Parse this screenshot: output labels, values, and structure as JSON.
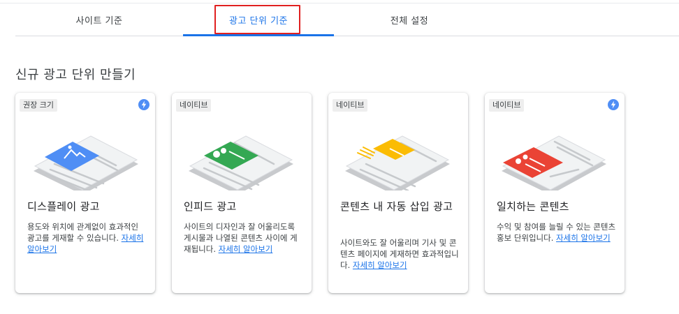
{
  "tabs": [
    {
      "label": "사이트 기준",
      "active": false
    },
    {
      "label": "광고 단위 기준",
      "active": true
    },
    {
      "label": "전체 설정",
      "active": false
    }
  ],
  "section_title": "신규 광고 단위 만들기",
  "colors": {
    "accent": "#1a73e8",
    "highlight_box": "#e02020",
    "display": "#4f8ef5",
    "infeed": "#34a853",
    "inarticle": "#fbbc04",
    "matched": "#ea4335"
  },
  "cards": [
    {
      "badge": "권장 크기",
      "has_bolt": true,
      "icon": "display-ad-illustration",
      "title": "디스플레이 광고",
      "desc": "용도와 위치에 관계없이 효과적인 광고를 게재할 수 있습니다. ",
      "link": "자세히 알아보기"
    },
    {
      "badge": "네이티브",
      "has_bolt": false,
      "icon": "infeed-ad-illustration",
      "title": "인피드 광고",
      "desc": "사이트의 디자인과 잘 어울리도록 게시물과 나열된 콘텐츠 사이에 게재됩니다. ",
      "link": "자세히 알아보기"
    },
    {
      "badge": "네이티브",
      "has_bolt": false,
      "icon": "in-article-ad-illustration",
      "title": "콘텐츠 내 자동 삽입 광고",
      "desc": "사이트와도 잘 어울리며 기사 및 콘텐츠 페이지에 게재하면 효과적입니다. ",
      "link": "자세히 알아보기"
    },
    {
      "badge": "네이티브",
      "has_bolt": true,
      "icon": "matched-content-illustration",
      "title": "일치하는 콘텐츠",
      "desc": "수익 및 참여를 늘릴 수 있는 콘텐츠 홍보 단위입니다. ",
      "link": "자세히 알아보기"
    }
  ]
}
